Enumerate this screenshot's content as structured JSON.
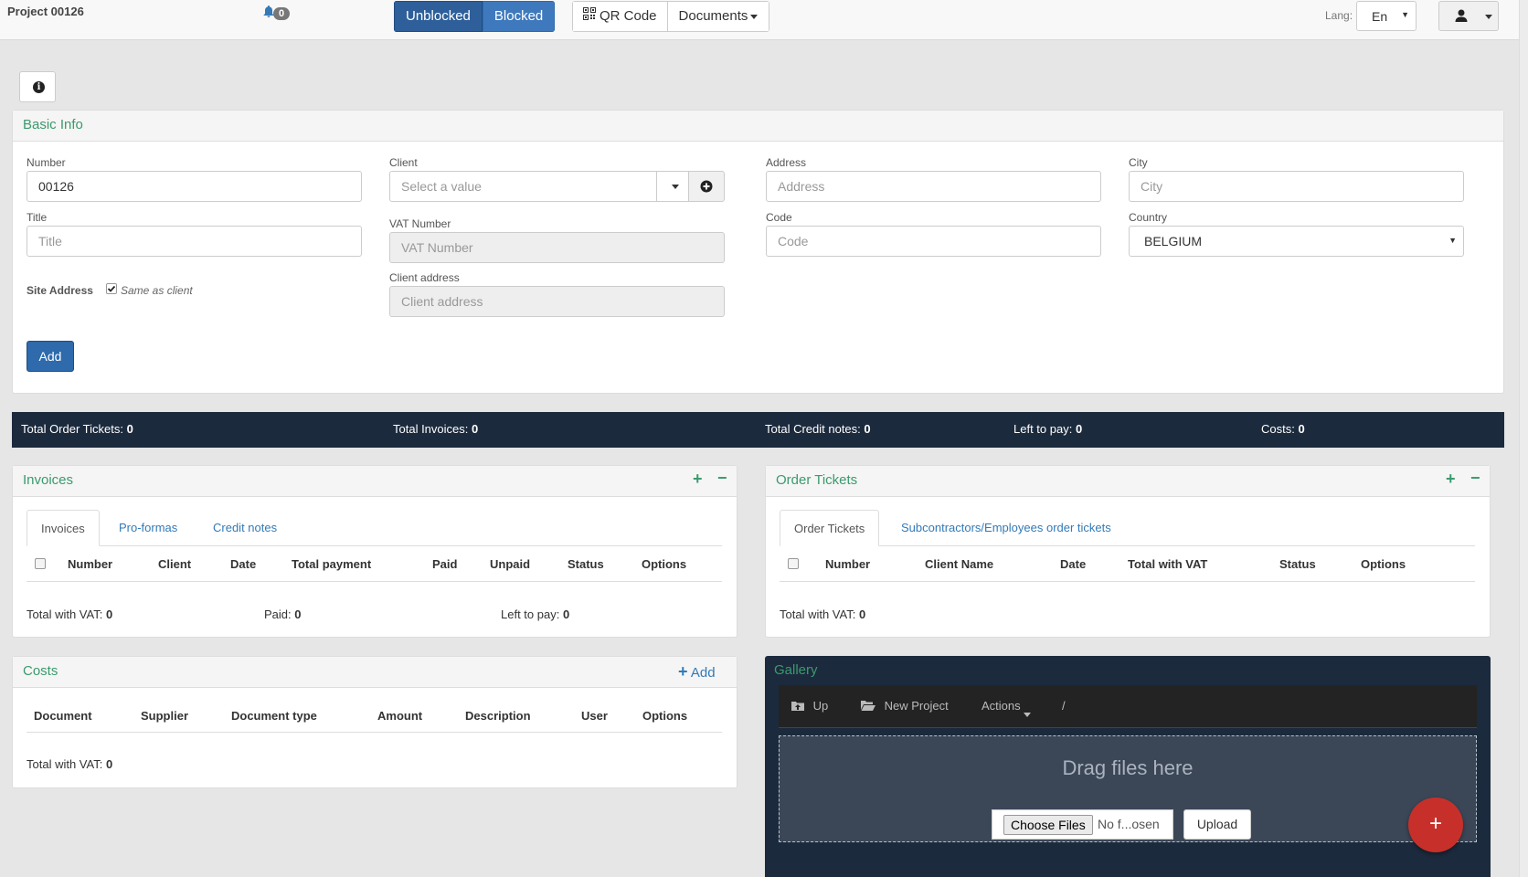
{
  "topbar": {
    "project_title": "Project 00126",
    "notifications_count": "0",
    "blocked_toggle": {
      "unblocked_label": "Unblocked",
      "blocked_label": "Blocked"
    },
    "qr_code_label": "QR Code",
    "documents_label": "Documents",
    "lang_label": "Lang:",
    "lang_value": "En"
  },
  "basic_info": {
    "title": "Basic Info",
    "number_label": "Number",
    "number_value": "00126",
    "title_label": "Title",
    "title_placeholder": "Title",
    "site_address_label": "Site Address",
    "same_as_client_label": "Same as client",
    "client_label": "Client",
    "client_placeholder": "Select a value",
    "vat_label": "VAT Number",
    "vat_placeholder": "VAT Number",
    "client_address_label": "Client address",
    "client_address_placeholder": "Client address",
    "address_label": "Address",
    "address_placeholder": "Address",
    "code_label": "Code",
    "code_placeholder": "Code",
    "city_label": "City",
    "city_placeholder": "City",
    "country_label": "Country",
    "country_value": "BELGIUM",
    "add_button": "Add"
  },
  "totals": {
    "order_tickets_label": "Total Order Tickets:",
    "order_tickets_value": "0",
    "invoices_label": "Total Invoices:",
    "invoices_value": "0",
    "credit_notes_label": "Total Credit notes:",
    "credit_notes_value": "0",
    "left_to_pay_label": "Left to pay:",
    "left_to_pay_value": "0",
    "costs_label": "Costs:",
    "costs_value": "0"
  },
  "invoices": {
    "title": "Invoices",
    "tabs": [
      "Invoices",
      "Pro-formas",
      "Credit notes"
    ],
    "columns": [
      "Number",
      "Client",
      "Date",
      "Total payment",
      "Paid",
      "Unpaid",
      "Status",
      "Options"
    ],
    "total_vat_label": "Total with VAT:",
    "total_vat_value": "0",
    "paid_label": "Paid:",
    "paid_value": "0",
    "left_label": "Left to pay:",
    "left_value": "0"
  },
  "order_tickets": {
    "title": "Order Tickets",
    "tabs": [
      "Order Tickets",
      "Subcontractors/Employees order tickets"
    ],
    "columns": [
      "Number",
      "Client Name",
      "Date",
      "Total with VAT",
      "Status",
      "Options"
    ],
    "total_vat_label": "Total with VAT:",
    "total_vat_value": "0"
  },
  "costs": {
    "title": "Costs",
    "add_label": "Add",
    "columns": [
      "Document",
      "Supplier",
      "Document type",
      "Amount",
      "Description",
      "User",
      "Options"
    ],
    "total_vat_label": "Total with VAT:",
    "total_vat_value": "0"
  },
  "gallery": {
    "title": "Gallery",
    "up_label": "Up",
    "new_project_label": "New Project",
    "actions_label": "Actions",
    "path": "/",
    "drop_text": "Drag files here",
    "choose_files_label": "Choose Files",
    "no_file_label": "No f...osen",
    "upload_label": "Upload",
    "fab_label": "+"
  },
  "colors": {
    "accent_green": "#3b9a6e",
    "primary_blue": "#337ab7",
    "dark_navy": "#1c2a3d",
    "fab_red": "#c7302a"
  }
}
